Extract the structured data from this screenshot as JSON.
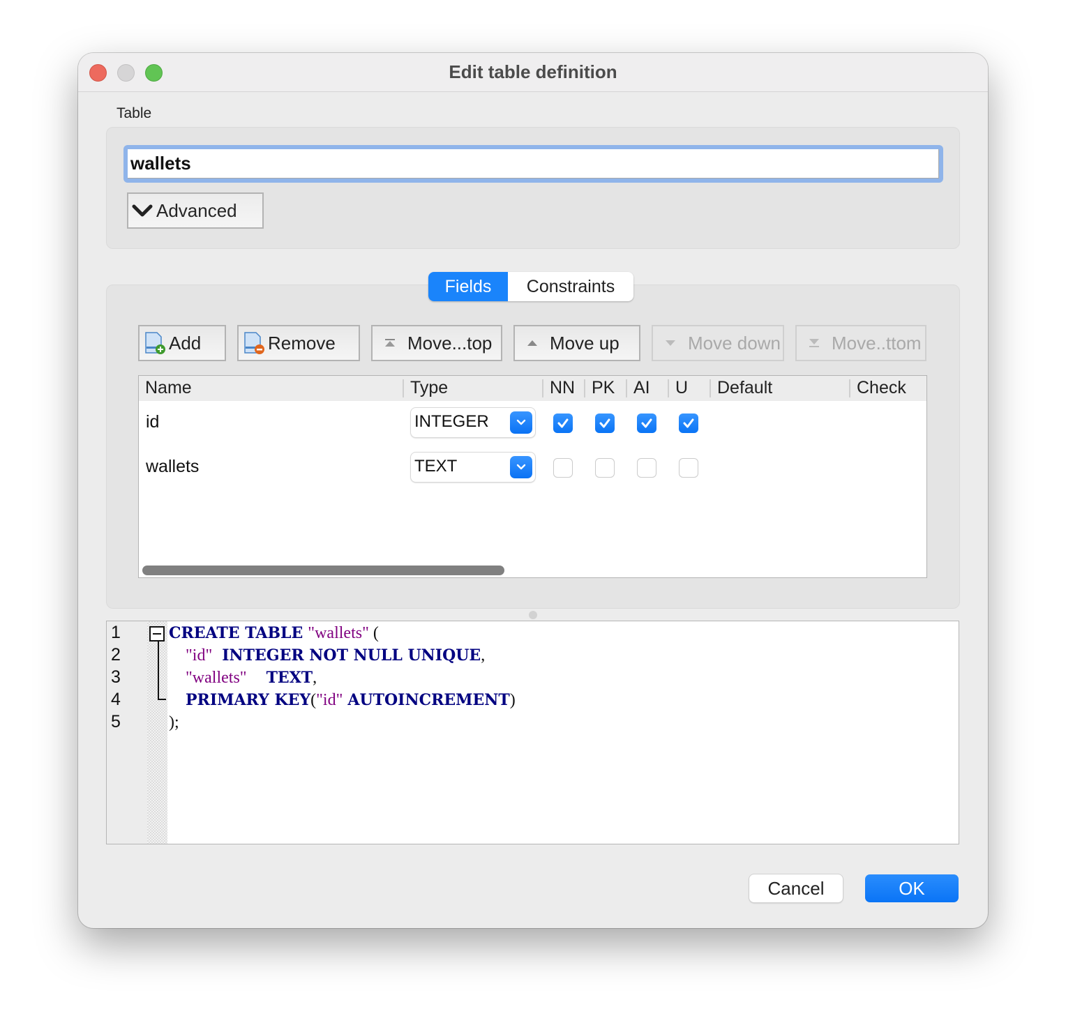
{
  "window": {
    "title": "Edit table definition",
    "controls": [
      "close",
      "minimize",
      "zoom"
    ]
  },
  "table_section": {
    "label": "Table",
    "table_name": "wallets",
    "advanced_label": "Advanced",
    "advanced_icon": "chevron-down-icon"
  },
  "tabs": [
    {
      "label": "Fields",
      "active": true
    },
    {
      "label": "Constraints",
      "active": false
    }
  ],
  "toolbar": {
    "add": {
      "label": "Add",
      "icon": "add-field-icon",
      "enabled": true
    },
    "remove": {
      "label": "Remove",
      "icon": "remove-field-icon",
      "enabled": true
    },
    "move_top": {
      "label": "Move...top",
      "icon": "move-top-icon",
      "enabled": true
    },
    "move_up": {
      "label": "Move up",
      "icon": "move-up-icon",
      "enabled": true
    },
    "move_down": {
      "label": "Move down",
      "icon": "move-down-icon",
      "enabled": false
    },
    "move_bottom": {
      "label": "Move..ttom",
      "icon": "move-bottom-icon",
      "enabled": false
    }
  },
  "fields_table": {
    "columns": [
      "Name",
      "Type",
      "NN",
      "PK",
      "AI",
      "U",
      "Default",
      "Check"
    ],
    "rows": [
      {
        "name": "id",
        "type": "INTEGER",
        "nn": true,
        "pk": true,
        "ai": true,
        "u": true,
        "default": "",
        "check": ""
      },
      {
        "name": "wallets",
        "type": "TEXT",
        "nn": false,
        "pk": false,
        "ai": false,
        "u": false,
        "default": "",
        "check": ""
      }
    ]
  },
  "sql_editor": {
    "line_numbers": [
      "1",
      "2",
      "3",
      "4",
      "5"
    ],
    "lines": {
      "l1": {
        "kw": "CREATE TABLE",
        "str": "\"wallets\"",
        "punc": " ("
      },
      "l2": {
        "str": "\"id\"",
        "kw": "INTEGER NOT NULL UNIQUE",
        "punc": ","
      },
      "l3": {
        "str": "\"wallets\"",
        "kw": "TEXT",
        "punc": ","
      },
      "l4": {
        "kw1": "PRIMARY KEY",
        "punc1": "(",
        "str": "\"id\"",
        "kw2": "AUTOINCREMENT",
        "punc2": ")"
      },
      "l5": {
        "punc": ");"
      }
    }
  },
  "buttons": {
    "cancel": "Cancel",
    "ok": "OK"
  },
  "colors": {
    "accent": "#1a84fb",
    "keyword": "#000080",
    "string": "#800080",
    "focus_ring": "#8fb4ea"
  }
}
